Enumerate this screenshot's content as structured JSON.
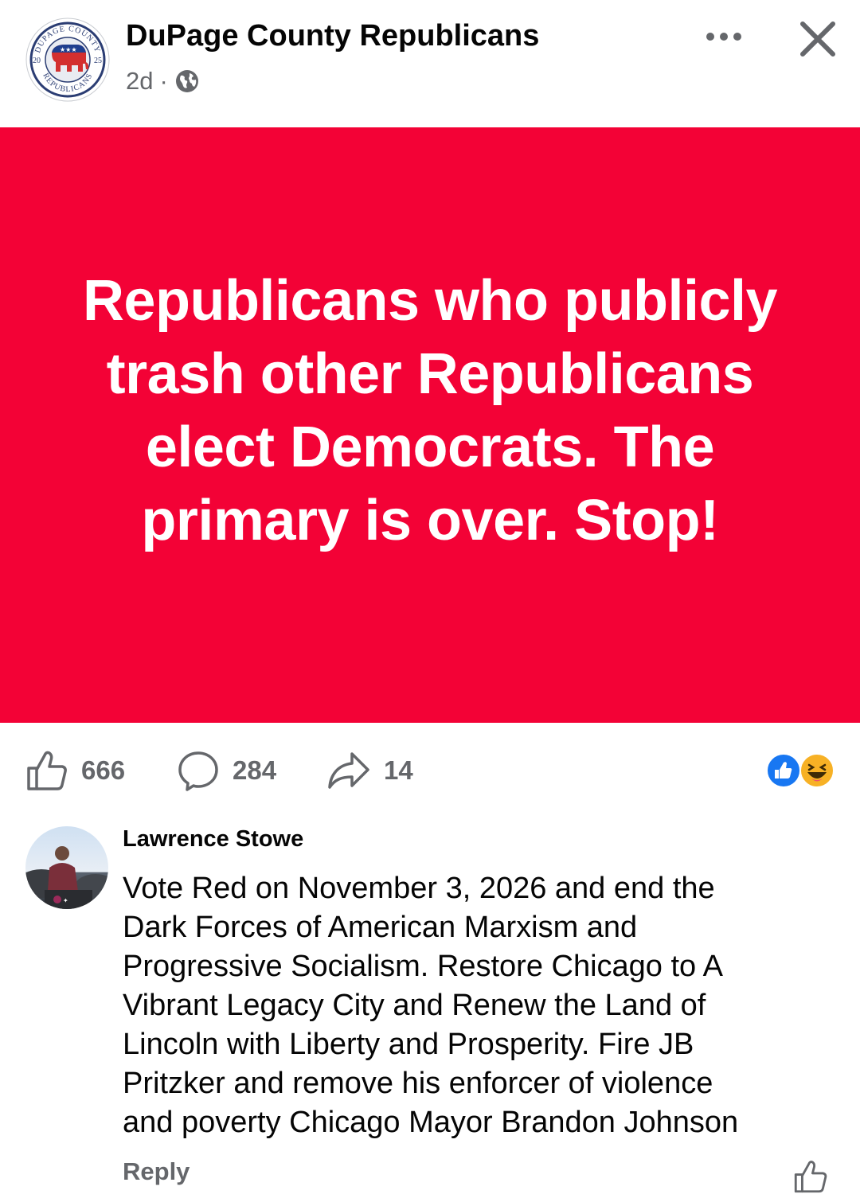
{
  "post": {
    "page_name": "DuPage County Republicans",
    "time": "2d",
    "separator": "·",
    "audience_icon": "globe-icon",
    "more_icon": "more-dots-icon",
    "close_icon": "close-icon",
    "logo": {
      "top_text": "DUPAGE COUNTY",
      "bottom_text": "REPUBLICANS",
      "year_left": "20",
      "year_right": "25"
    },
    "banner": {
      "background": "#f30236",
      "text_color": "#ffffff",
      "text": "Republicans who publicly trash other Republicans elect Democrats. The primary is over. Stop!"
    }
  },
  "actions": {
    "like_count": "666",
    "comment_count": "284",
    "share_count": "14",
    "reaction_icons": [
      "like-reaction-icon",
      "haha-reaction-icon"
    ]
  },
  "comment": {
    "author": "Lawrence Stowe",
    "text": "Vote Red on November 3, 2026  and end the\nDark Forces of American Marxism and\nProgressive Socialism. Restore Chicago to A\nVibrant Legacy City and Renew the Land of\nLincoln with Liberty and Prosperity. Fire JB\nPritzker and remove  his enforcer of violence\nand poverty Chicago Mayor Brandon Johnson",
    "reply_label": "Reply"
  },
  "colors": {
    "text_primary": "#050505",
    "text_secondary": "#65676b",
    "banner_red": "#f30236",
    "like_blue": "#1877f2",
    "haha_yellow": "#f7b125"
  }
}
